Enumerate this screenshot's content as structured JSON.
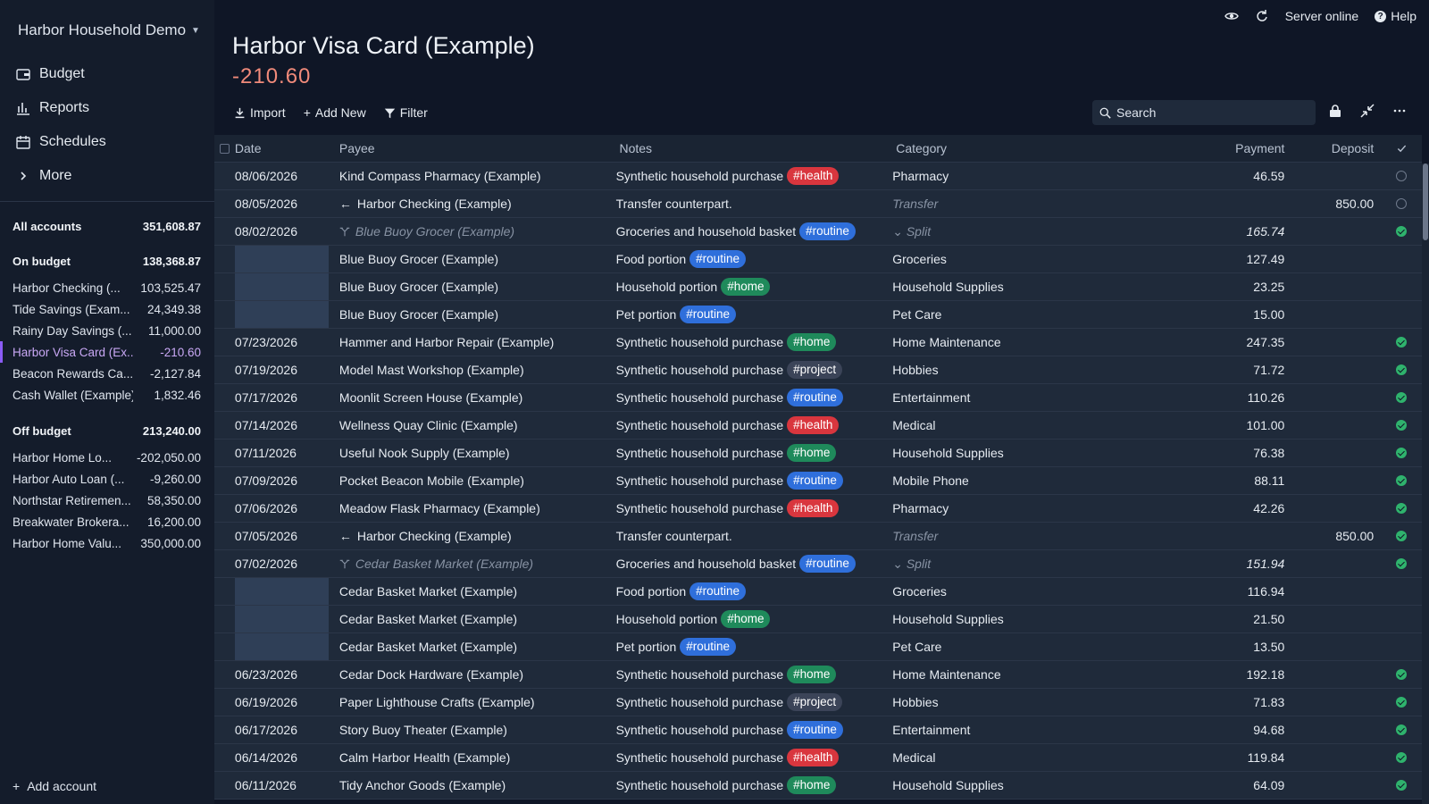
{
  "app": {
    "budget_name": "Harbor Household Demo",
    "nav": [
      {
        "label": "Budget",
        "icon": "wallet-icon"
      },
      {
        "label": "Reports",
        "icon": "bar-chart-icon"
      },
      {
        "label": "Schedules",
        "icon": "calendar-icon"
      },
      {
        "label": "More",
        "icon": "chevron-right-icon"
      }
    ],
    "status": "Server online",
    "help": "Help"
  },
  "accounts": {
    "all": {
      "label": "All accounts",
      "value": "351,608.87"
    },
    "on_budget": {
      "label": "On budget",
      "value": "138,368.87"
    },
    "on_list": [
      {
        "name": "Harbor Checking (...",
        "value": "103,525.47"
      },
      {
        "name": "Tide Savings (Exam...",
        "value": "24,349.38"
      },
      {
        "name": "Rainy Day Savings (...",
        "value": "11,000.00"
      },
      {
        "name": "Harbor Visa Card (Ex...",
        "value": "-210.60",
        "selected": true
      },
      {
        "name": "Beacon Rewards Ca...",
        "value": "-2,127.84"
      },
      {
        "name": "Cash Wallet (Example)",
        "value": "1,832.46"
      }
    ],
    "off_budget": {
      "label": "Off budget",
      "value": "213,240.00"
    },
    "off_list": [
      {
        "name": "Harbor Home Lo...",
        "value": "-202,050.00"
      },
      {
        "name": "Harbor Auto Loan (...",
        "value": "-9,260.00"
      },
      {
        "name": "Northstar Retiremen...",
        "value": "58,350.00"
      },
      {
        "name": "Breakwater Brokera...",
        "value": "16,200.00"
      },
      {
        "name": "Harbor Home Valu...",
        "value": "350,000.00"
      }
    ],
    "add_label": "Add account"
  },
  "account": {
    "title": "Harbor Visa Card (Example)",
    "balance": "-210.60"
  },
  "toolbar": {
    "import": "Import",
    "add_new": "Add New",
    "filter": "Filter",
    "search_placeholder": "Search"
  },
  "columns": {
    "date": "Date",
    "payee": "Payee",
    "notes": "Notes",
    "category": "Category",
    "payment": "Payment",
    "deposit": "Deposit"
  },
  "transactions": [
    {
      "date": "08/06/2026",
      "payee": "Kind Compass Pharmacy (Example)",
      "notes": "Synthetic household purchase",
      "tag": "#health",
      "tagc": "health",
      "category": "Pharmacy",
      "payment": "46.59",
      "deposit": "",
      "cleared": "empty"
    },
    {
      "date": "08/05/2026",
      "payee": "Harbor Checking (Example)",
      "transfer": true,
      "notes": "Transfer counterpart.",
      "tag": "",
      "tagc": "",
      "category": "Transfer",
      "catmuted": true,
      "payment": "",
      "deposit": "850.00",
      "cleared": "empty"
    },
    {
      "date": "08/02/2026",
      "payee": "Blue Buoy Grocer (Example)",
      "split_parent": true,
      "notes": "Groceries and household basket",
      "tag": "#routine",
      "tagc": "routine",
      "category": "Split",
      "payment": "165.74",
      "deposit": "",
      "cleared": "ok"
    },
    {
      "sub": true,
      "payee": "Blue Buoy Grocer (Example)",
      "notes": "Food portion",
      "tag": "#routine",
      "tagc": "routine",
      "category": "Groceries",
      "payment": "127.49",
      "deposit": ""
    },
    {
      "sub": true,
      "payee": "Blue Buoy Grocer (Example)",
      "notes": "Household portion",
      "tag": "#home",
      "tagc": "home",
      "category": "Household Supplies",
      "payment": "23.25",
      "deposit": ""
    },
    {
      "sub": true,
      "payee": "Blue Buoy Grocer (Example)",
      "notes": "Pet portion",
      "tag": "#routine",
      "tagc": "routine",
      "category": "Pet Care",
      "payment": "15.00",
      "deposit": ""
    },
    {
      "date": "07/23/2026",
      "payee": "Hammer and Harbor Repair (Example)",
      "notes": "Synthetic household purchase",
      "tag": "#home",
      "tagc": "home",
      "category": "Home Maintenance",
      "payment": "247.35",
      "deposit": "",
      "cleared": "ok"
    },
    {
      "date": "07/19/2026",
      "payee": "Model Mast Workshop (Example)",
      "notes": "Synthetic household purchase",
      "tag": "#project",
      "tagc": "project",
      "category": "Hobbies",
      "payment": "71.72",
      "deposit": "",
      "cleared": "ok"
    },
    {
      "date": "07/17/2026",
      "payee": "Moonlit Screen House (Example)",
      "notes": "Synthetic household purchase",
      "tag": "#routine",
      "tagc": "routine",
      "category": "Entertainment",
      "payment": "110.26",
      "deposit": "",
      "cleared": "ok"
    },
    {
      "date": "07/14/2026",
      "payee": "Wellness Quay Clinic (Example)",
      "notes": "Synthetic household purchase",
      "tag": "#health",
      "tagc": "health",
      "category": "Medical",
      "payment": "101.00",
      "deposit": "",
      "cleared": "ok"
    },
    {
      "date": "07/11/2026",
      "payee": "Useful Nook Supply (Example)",
      "notes": "Synthetic household purchase",
      "tag": "#home",
      "tagc": "home",
      "category": "Household Supplies",
      "payment": "76.38",
      "deposit": "",
      "cleared": "ok"
    },
    {
      "date": "07/09/2026",
      "payee": "Pocket Beacon Mobile (Example)",
      "notes": "Synthetic household purchase",
      "tag": "#routine",
      "tagc": "routine",
      "category": "Mobile Phone",
      "payment": "88.11",
      "deposit": "",
      "cleared": "ok"
    },
    {
      "date": "07/06/2026",
      "payee": "Meadow Flask Pharmacy (Example)",
      "notes": "Synthetic household purchase",
      "tag": "#health",
      "tagc": "health",
      "category": "Pharmacy",
      "payment": "42.26",
      "deposit": "",
      "cleared": "ok"
    },
    {
      "date": "07/05/2026",
      "payee": "Harbor Checking (Example)",
      "transfer": true,
      "notes": "Transfer counterpart.",
      "tag": "",
      "tagc": "",
      "category": "Transfer",
      "catmuted": true,
      "payment": "",
      "deposit": "850.00",
      "cleared": "ok"
    },
    {
      "date": "07/02/2026",
      "payee": "Cedar Basket Market (Example)",
      "split_parent": true,
      "notes": "Groceries and household basket",
      "tag": "#routine",
      "tagc": "routine",
      "category": "Split",
      "payment": "151.94",
      "deposit": "",
      "cleared": "ok"
    },
    {
      "sub": true,
      "payee": "Cedar Basket Market (Example)",
      "notes": "Food portion",
      "tag": "#routine",
      "tagc": "routine",
      "category": "Groceries",
      "payment": "116.94",
      "deposit": ""
    },
    {
      "sub": true,
      "payee": "Cedar Basket Market (Example)",
      "notes": "Household portion",
      "tag": "#home",
      "tagc": "home",
      "category": "Household Supplies",
      "payment": "21.50",
      "deposit": ""
    },
    {
      "sub": true,
      "payee": "Cedar Basket Market (Example)",
      "notes": "Pet portion",
      "tag": "#routine",
      "tagc": "routine",
      "category": "Pet Care",
      "payment": "13.50",
      "deposit": ""
    },
    {
      "date": "06/23/2026",
      "payee": "Cedar Dock Hardware (Example)",
      "notes": "Synthetic household purchase",
      "tag": "#home",
      "tagc": "home",
      "category": "Home Maintenance",
      "payment": "192.18",
      "deposit": "",
      "cleared": "ok"
    },
    {
      "date": "06/19/2026",
      "payee": "Paper Lighthouse Crafts (Example)",
      "notes": "Synthetic household purchase",
      "tag": "#project",
      "tagc": "project",
      "category": "Hobbies",
      "payment": "71.83",
      "deposit": "",
      "cleared": "ok"
    },
    {
      "date": "06/17/2026",
      "payee": "Story Buoy Theater (Example)",
      "notes": "Synthetic household purchase",
      "tag": "#routine",
      "tagc": "routine",
      "category": "Entertainment",
      "payment": "94.68",
      "deposit": "",
      "cleared": "ok"
    },
    {
      "date": "06/14/2026",
      "payee": "Calm Harbor Health (Example)",
      "notes": "Synthetic household purchase",
      "tag": "#health",
      "tagc": "health",
      "category": "Medical",
      "payment": "119.84",
      "deposit": "",
      "cleared": "ok"
    },
    {
      "date": "06/11/2026",
      "payee": "Tidy Anchor Goods (Example)",
      "notes": "Synthetic household purchase",
      "tag": "#home",
      "tagc": "home",
      "category": "Household Supplies",
      "payment": "64.09",
      "deposit": "",
      "cleared": "ok"
    }
  ],
  "colors": {
    "accent": "#8b5cf6",
    "negative": "#f08a7a",
    "cleared": "#2fb36d"
  }
}
